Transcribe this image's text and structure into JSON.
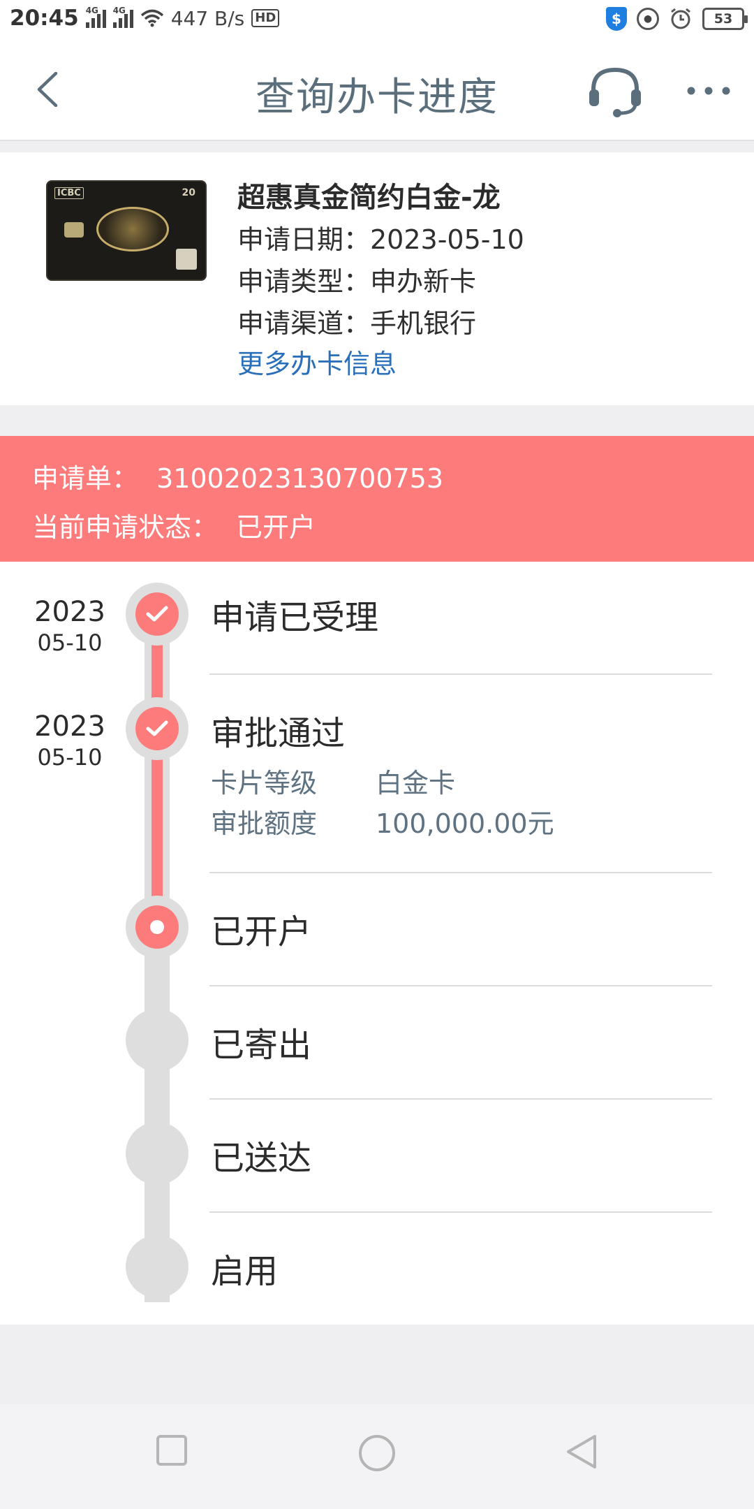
{
  "status_bar": {
    "time": "20:45",
    "network_1": "4G",
    "network_2": "4G",
    "speed": "447 B/s",
    "hd": "HD",
    "shield_symbol": "$",
    "battery": "53"
  },
  "header": {
    "title": "查询办卡进度",
    "icons": [
      "back-arrow-icon",
      "customer-service-headset-icon",
      "more-dots-icon"
    ]
  },
  "card": {
    "name": "超惠真金简约白金-龙",
    "apply_date": "申请日期：2023-05-10",
    "apply_type": "申请类型：申办新卡",
    "apply_channel": "申请渠道：手机银行",
    "more_link": "更多办卡信息",
    "thumb_bank_logo": "ICBC",
    "thumb_badge": "20"
  },
  "application": {
    "number_label": "申请单：",
    "number_value": "31002023130700753",
    "status_label": "当前申请状态：",
    "status_value": "已开户"
  },
  "timeline": {
    "steps": [
      {
        "year": "2023",
        "monthday": "05-10",
        "title": "申请已受理",
        "state": "done"
      },
      {
        "year": "2023",
        "monthday": "05-10",
        "title": "审批通过",
        "state": "done",
        "details": [
          {
            "key": "卡片等级",
            "value": "白金卡"
          },
          {
            "key": "审批额度",
            "value": "100,000.00元"
          }
        ]
      },
      {
        "title": "已开户",
        "state": "current"
      },
      {
        "title": "已寄出",
        "state": "pending"
      },
      {
        "title": "已送达",
        "state": "pending"
      },
      {
        "title": "启用",
        "state": "pending"
      }
    ]
  },
  "colors": {
    "accent": "#fd7c7b",
    "link": "#2a6fba",
    "title_text": "#5b6e7c",
    "detail_text": "#5e7282",
    "track_grey": "#dedede"
  },
  "system_nav": {
    "icons": [
      "recent-apps-icon",
      "home-icon",
      "back-triangle-icon"
    ]
  }
}
